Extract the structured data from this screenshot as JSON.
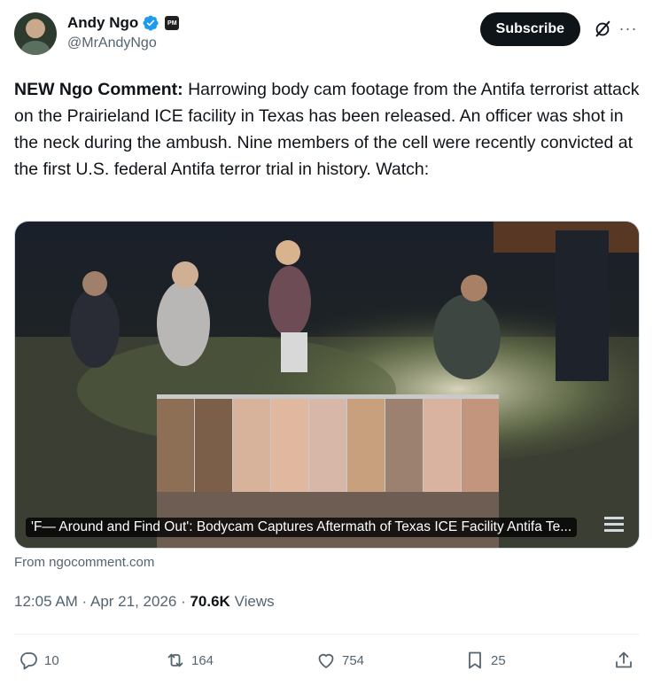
{
  "author": {
    "display_name": "Andy Ngo",
    "handle": "@MrAndyNgo",
    "affiliation_badge": "PM"
  },
  "header": {
    "subscribe_label": "Subscribe",
    "grok_icon": "slashed-circle-icon",
    "more_icon": "more-icon",
    "more_glyph": "···"
  },
  "tweet": {
    "lead": "NEW Ngo Comment:",
    "body": " Harrowing body cam footage from the Antifa terrorist attack on the Prairieland ICE facility in Texas has been released. An officer was shot in the neck during the ambush. Nine members of the cell were recently convicted at the first U.S. federal Antifa terror trial in history. Watch:"
  },
  "card": {
    "title": "'F— Around and Find Out': Bodycam Captures Aftermath of Texas ICE Facility Antifa Te...",
    "source": "From ngocomment.com"
  },
  "meta": {
    "time": "12:05 AM",
    "date": "Apr 21, 2026",
    "separator": " · ",
    "views_count": "70.6K",
    "views_label": " Views"
  },
  "actions": {
    "replies": "10",
    "reposts": "164",
    "likes": "754",
    "bookmarks": "25"
  },
  "colors": {
    "text": "#0f1419",
    "secondary": "#536471",
    "verified": "#1d9bf0",
    "divider": "#eff3f4"
  }
}
